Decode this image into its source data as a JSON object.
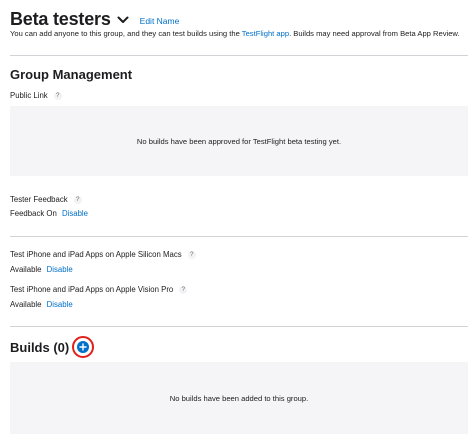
{
  "header": {
    "title": "Beta testers",
    "edit_label": "Edit Name",
    "subtitle_pre": "You can add anyone to this group, and they can test builds using the ",
    "subtitle_link": "TestFlight app",
    "subtitle_post": ". Builds may need approval from Beta App Review."
  },
  "group_management": {
    "title": "Group Management",
    "public_link_label": "Public Link",
    "public_link_empty": "No builds have been approved for TestFlight beta testing yet.",
    "tester_feedback_label": "Tester Feedback",
    "feedback_status": "Feedback On",
    "feedback_action": "Disable",
    "silicon_label": "Test iPhone and iPad Apps on Apple Silicon Macs",
    "silicon_status": "Available",
    "silicon_action": "Disable",
    "vision_label": "Test iPhone and iPad Apps on Apple Vision Pro",
    "vision_status": "Available",
    "vision_action": "Disable",
    "help_glyph": "?"
  },
  "builds": {
    "title": "Builds (0)",
    "empty": "No builds have been added to this group."
  },
  "colors": {
    "accent": "#0070c9",
    "highlight_ring": "#e0201b",
    "box_bg": "#f5f5f7"
  },
  "icons": {
    "title_chevron": "chevron-down-icon",
    "help": "question-icon",
    "add": "plus-icon"
  }
}
